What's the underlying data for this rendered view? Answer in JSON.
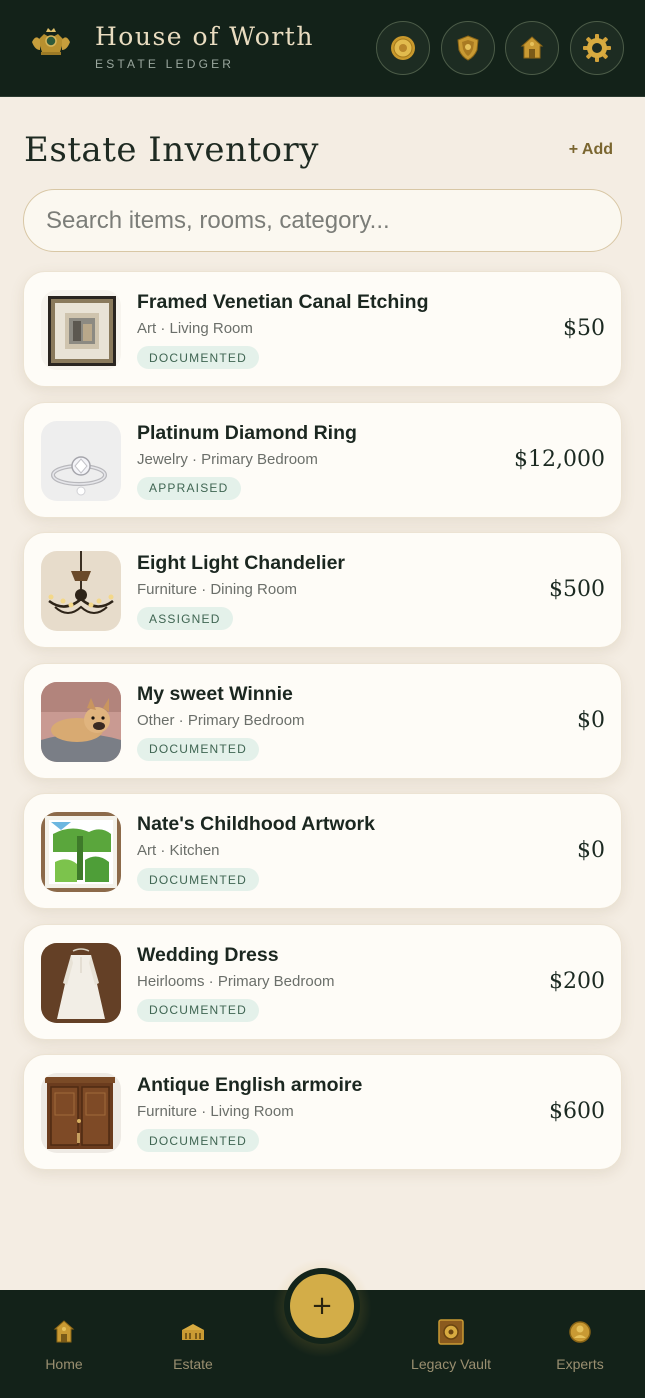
{
  "header": {
    "title": "House of Worth",
    "subtitle": "ESTATE LEDGER",
    "icons": [
      "crest-icon",
      "coin-icon",
      "shield-icon",
      "house-icon",
      "gear-icon"
    ]
  },
  "page": {
    "title": "Estate Inventory",
    "add_label": "+ Add",
    "search_placeholder": "Search items, rooms, category..."
  },
  "items": [
    {
      "name": "Framed Venetian Canal Etching",
      "meta": "Art · Living Room",
      "status": "DOCUMENTED",
      "price": "$50",
      "thumb": "framed-etching"
    },
    {
      "name": "Platinum Diamond Ring",
      "meta": "Jewelry · Primary Bedroom",
      "status": "APPRAISED",
      "price": "$12,000",
      "thumb": "diamond-ring"
    },
    {
      "name": "Eight Light Chandelier",
      "meta": "Furniture · Dining Room",
      "status": "ASSIGNED",
      "price": "$500",
      "thumb": "chandelier"
    },
    {
      "name": "My sweet Winnie",
      "meta": "Other · Primary Bedroom",
      "status": "DOCUMENTED",
      "price": "$0",
      "thumb": "dog"
    },
    {
      "name": "Nate's Childhood Artwork",
      "meta": "Art · Kitchen",
      "status": "DOCUMENTED",
      "price": "$0",
      "thumb": "child-painting"
    },
    {
      "name": "Wedding Dress",
      "meta": "Heirlooms · Primary Bedroom",
      "status": "DOCUMENTED",
      "price": "$200",
      "thumb": "wedding-dress"
    },
    {
      "name": "Antique English armoire",
      "meta": "Furniture · Living Room",
      "status": "DOCUMENTED",
      "price": "$600",
      "thumb": "armoire"
    }
  ],
  "nav": {
    "home": "Home",
    "estate": "Estate",
    "add": "+",
    "vault": "Legacy Vault",
    "experts": "Experts"
  },
  "colors": {
    "header_bg": "#132219",
    "page_bg": "#f4ede3",
    "gold": "#d3ad48",
    "badge_bg": "#e4f1ea",
    "badge_text": "#3f6552"
  }
}
